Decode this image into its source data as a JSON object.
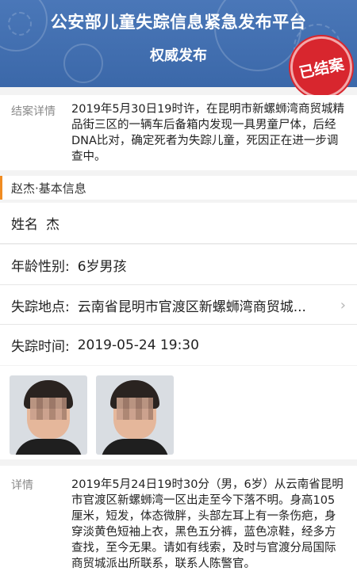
{
  "banner": {
    "title": "公安部儿童失踪信息紧急发布平台",
    "subtitle": "权威发布",
    "stamp": "已结案"
  },
  "case": {
    "label": "结案详情",
    "text": "2019年5月30日19时许，在昆明市新螺蛳湾商贸城精品街三区的一辆车后备箱内发现一具男童尸体，后经DNA比对，确定死者为失踪儿童，死因正在进一步调查中。"
  },
  "info": {
    "header": "赵杰·基本信息",
    "name_label": "姓名",
    "name_value": "杰",
    "age_label": "年龄性别:",
    "age_value": "6岁男孩",
    "loc_label": "失踪地点:",
    "loc_value": "云南省昆明市官渡区新螺蛳湾商贸城...",
    "time_label": "失踪时间:",
    "time_value": "2019-05-24 19:30"
  },
  "details": {
    "label": "详情",
    "text": "2019年5月24日19时30分（男，6岁）从云南省昆明市官渡区新螺蛳湾一区出走至今下落不明。身高105厘米，短发，体态微胖，头部左耳上有一条伤疤，身穿淡黄色短袖上衣，黑色五分裤，蓝色凉鞋，经多方查找，至今无果。请如有线索，及时与官渡分局国际商贸城派出所联系，联系人陈警官。"
  },
  "colors": {
    "banner": "#3b68a9",
    "stamp": "#d8262e",
    "accent": "#f08c22"
  }
}
